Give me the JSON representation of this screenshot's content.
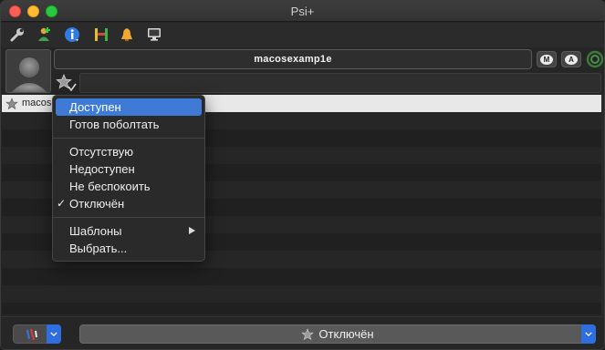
{
  "window": {
    "title": "Psi+"
  },
  "toolbar": {
    "icons": [
      "wrench-icon",
      "add-contact-icon",
      "info-icon",
      "server-icon",
      "bell-icon",
      "monitor-icon"
    ]
  },
  "account": {
    "nickname": "macosexamp1e",
    "roster_entry": "macosexample",
    "mood_badge": "M",
    "activity_badge": "A"
  },
  "status_menu": {
    "items": [
      {
        "label": "Доступен",
        "highlighted": true
      },
      {
        "label": "Готов поболтать"
      },
      {
        "label": "Отсутствую"
      },
      {
        "label": "Недоступен"
      },
      {
        "label": "Не беспокоить"
      },
      {
        "label": "Отключён",
        "checked": true
      },
      {
        "label": "Шаблоны",
        "submenu": true
      },
      {
        "label": "Выбрать..."
      }
    ],
    "check_glyph": "✓"
  },
  "bottom": {
    "status_value": "Отключён"
  },
  "colors": {
    "highlight": "#3f7bd6",
    "combo_arrow": "#2f6ee0"
  }
}
